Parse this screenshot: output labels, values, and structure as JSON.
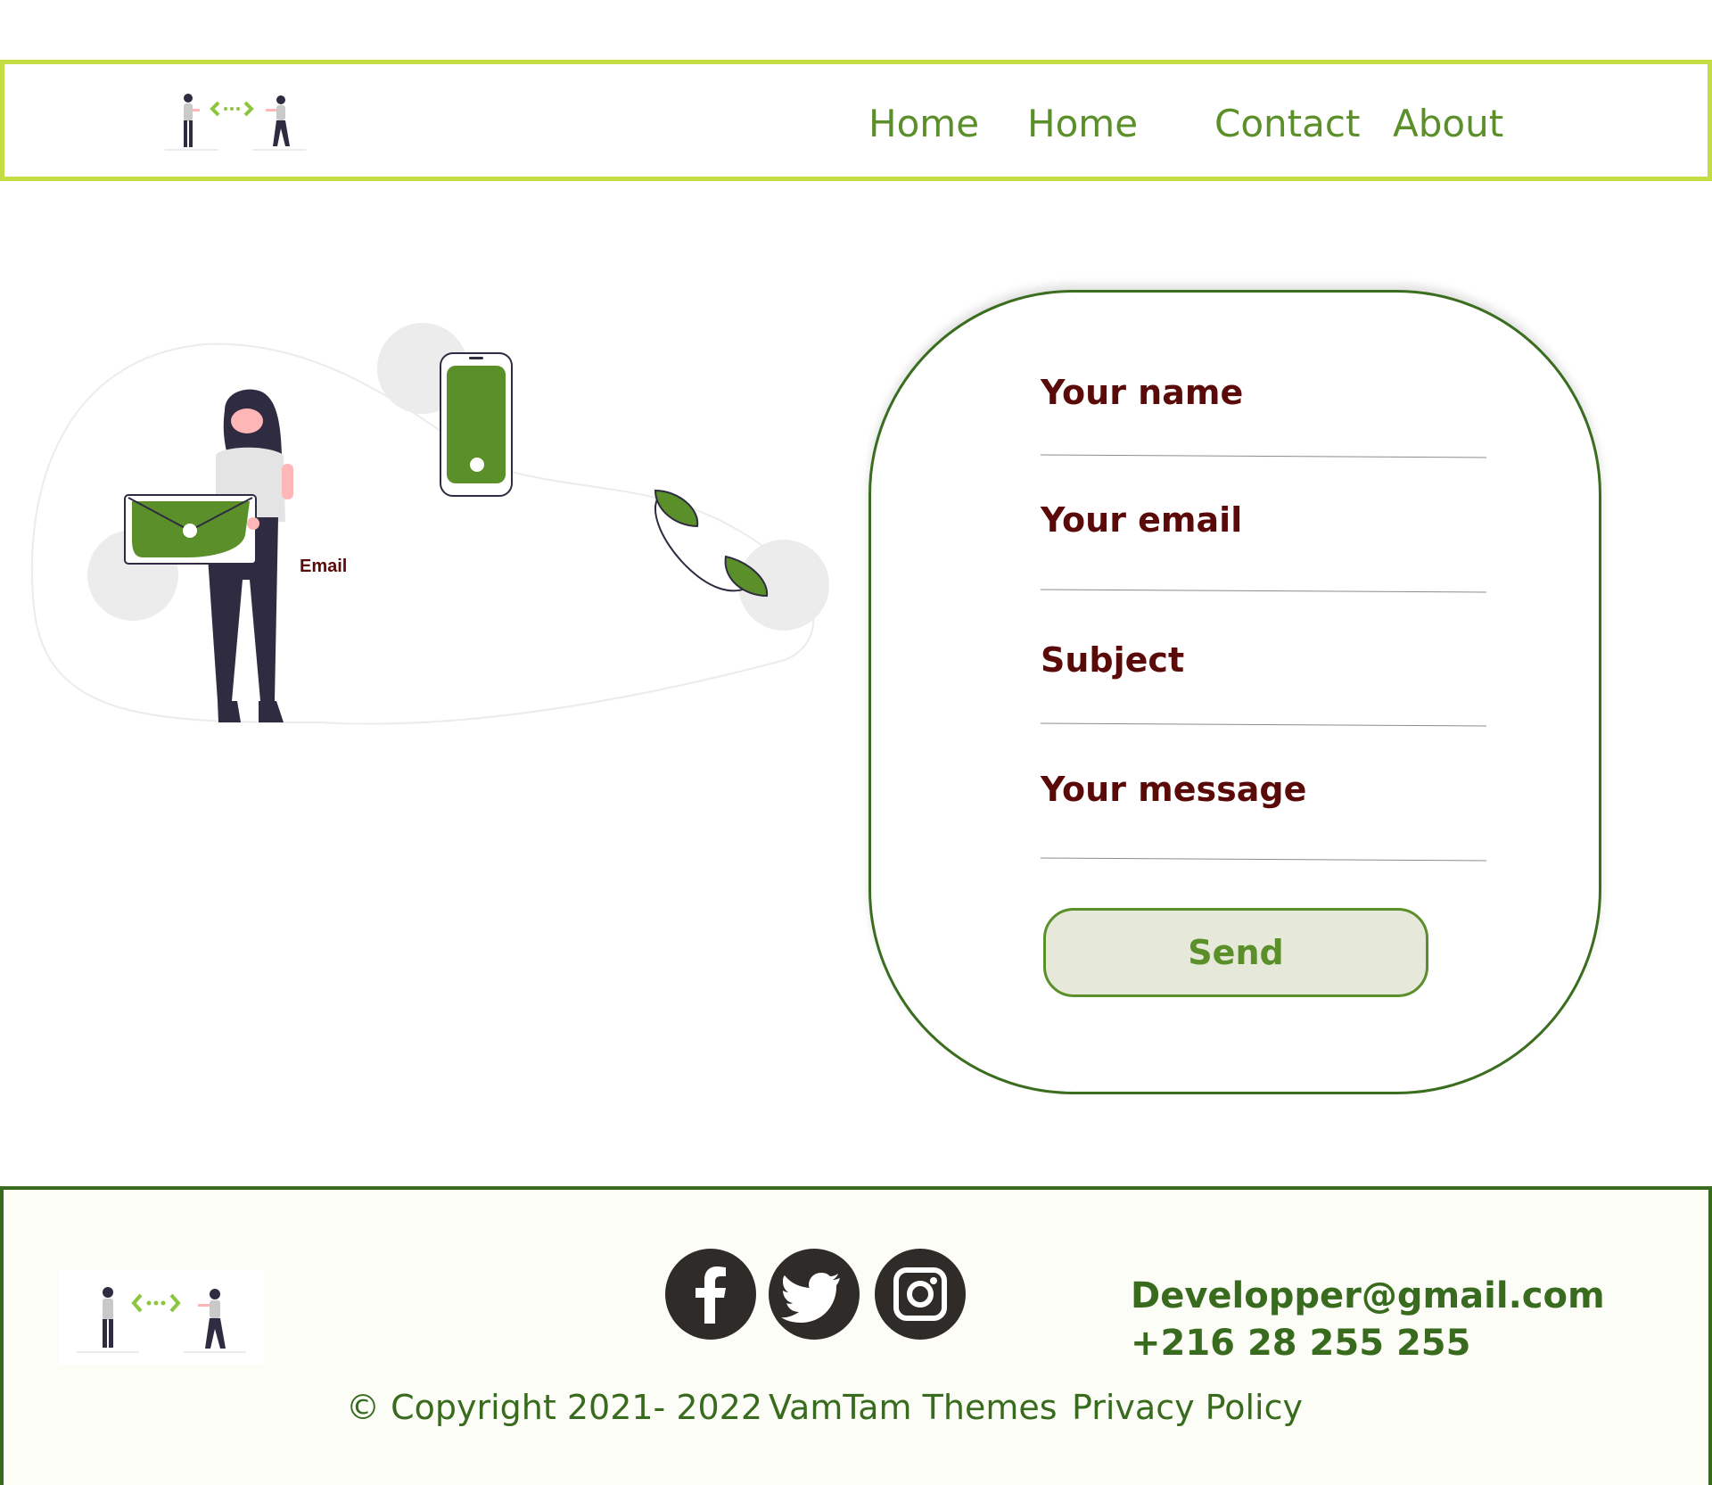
{
  "colors": {
    "header_border": "#c3dc44",
    "nav_text": "#5a8f29",
    "label_text": "#5b0a0a",
    "accent_green": "#5a8f29",
    "footer_green": "#386b1e",
    "icon_dark": "#2f2b28"
  },
  "header": {
    "logo_icon": "people-exchange-logo",
    "nav": [
      {
        "label": "Home"
      },
      {
        "label": "Home"
      },
      {
        "label": "Contact"
      },
      {
        "label": "About"
      }
    ]
  },
  "illustration": {
    "caption": "Email"
  },
  "form": {
    "fields": [
      {
        "label": "Your name"
      },
      {
        "label": "Your email"
      },
      {
        "label": "Subject"
      },
      {
        "label": "Your message"
      }
    ],
    "send_label": "Send"
  },
  "footer": {
    "logo_icon": "people-exchange-logo",
    "social": [
      {
        "icon": "facebook-icon"
      },
      {
        "icon": "twitter-icon"
      },
      {
        "icon": "instagram-icon"
      }
    ],
    "email": "Developper@gmail.com",
    "phone": "+216 28 255 255",
    "copyright": "© Copyright 2021- 2022",
    "themes": "VamTam Themes",
    "privacy": "Privacy Policy"
  }
}
